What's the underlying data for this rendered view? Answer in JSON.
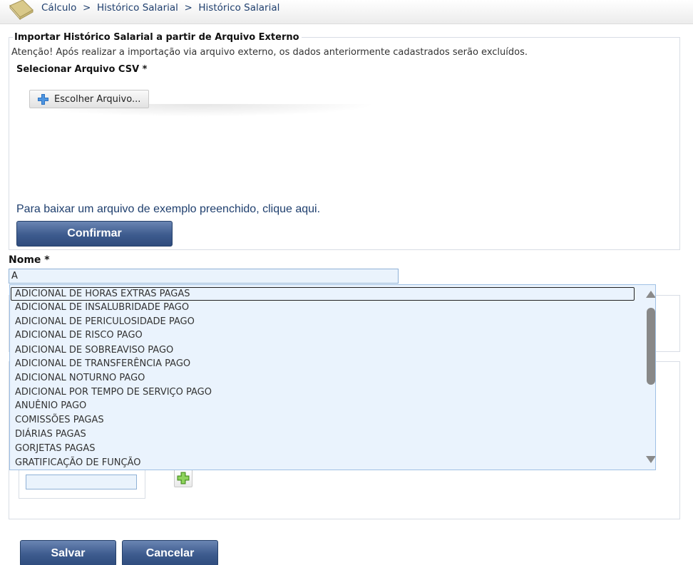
{
  "breadcrumb": [
    "Cálculo",
    "Histórico Salarial",
    "Histórico Salarial"
  ],
  "breadcrumb_separator": ">",
  "import_section": {
    "legend": "Importar Histórico Salarial a partir de Arquivo Externo",
    "warning": "Atenção! Após realizar a importação via arquivo externo, os dados anteriormente cadastrados serão excluídos.",
    "csv_label": "Selecionar Arquivo CSV *",
    "choose_button": "Escolher Arquivo...",
    "sample_link": "Para baixar um arquivo de exemplo preenchido, clique aqui.",
    "confirm_button": "Confirmar"
  },
  "nome": {
    "label": "Nome *",
    "value": "A"
  },
  "dropdown": {
    "options": [
      "ADICIONAL DE HORAS EXTRAS PAGAS",
      "ADICIONAL DE INSALUBRIDADE PAGO",
      "ADICIONAL DE PERICULOSIDADE PAGO",
      "ADICIONAL DE RISCO PAGO",
      "ADICIONAL DE SOBREAVISO PAGO",
      "ADICIONAL DE TRANSFERÊNCIA PAGO",
      "ADICIONAL NOTURNO PAGO",
      "ADICIONAL POR TEMPO DE SERVIÇO PAGO",
      "ANUÊNIO PAGO",
      "COMISSÕES PAGAS",
      "DIÁRIAS PAGAS",
      "GORJETAS PAGAS",
      "GRATIFICAÇÃO DE FUNÇÃO"
    ],
    "highlighted_index": 0
  },
  "footer": {
    "save_button": "Salvar",
    "cancel_button": "Cancelar"
  },
  "colors": {
    "button_blue": "#3d5b8e",
    "link_blue": "#1f3f6e",
    "dropdown_bg": "#eaf3fd",
    "add_green": "#6cbb3c"
  }
}
